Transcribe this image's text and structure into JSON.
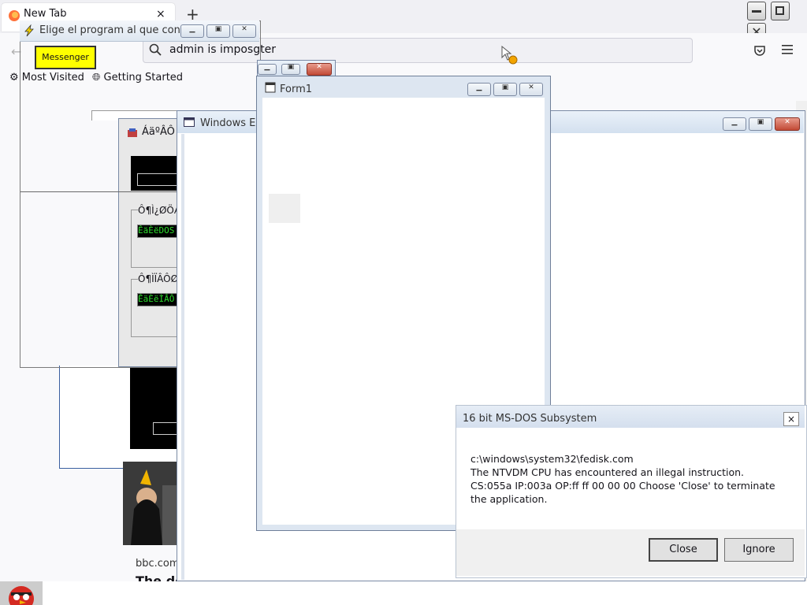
{
  "browser": {
    "tab_title": "New Tab",
    "tab_close": "×",
    "new_tab": "+",
    "url_text": "admin is imposgter",
    "bookmarks": [
      "Most Visited",
      "Getting Started"
    ]
  },
  "chooser_window": {
    "title": "Elige el program al que con...",
    "button_label": "Messenger"
  },
  "cn_window": {
    "title": "ÁäºÂÔ",
    "group1_label": "Ô¶Ì¿ØÖÆ",
    "group1_value": "ÊäÈëDOS",
    "group2_label": "Ô¶ÌÏÂÔØ",
    "group2_value": "ÊäÈëÌÂÔ"
  },
  "explorer_window": {
    "title": "Windows Ex"
  },
  "form_window": {
    "title": "Form1"
  },
  "news": {
    "source": "bbc.com",
    "headline": "The de"
  },
  "dos_dialog": {
    "title": "16 bit MS-DOS Subsystem",
    "close_x": "×",
    "line1": "c:\\windows\\system32\\fedisk.com",
    "line2": "The NTVDM CPU has encountered an illegal instruction.",
    "line3": "CS:055a IP:003a OP:ff ff 00 00 00 Choose 'Close' to terminate the application.",
    "btn_close": "Close",
    "btn_ignore": "Ignore"
  },
  "colors": {
    "messenger_bg": "#ffff00",
    "title_close_red": "#c24a36",
    "dos_text_green": "#2ddc2d"
  }
}
